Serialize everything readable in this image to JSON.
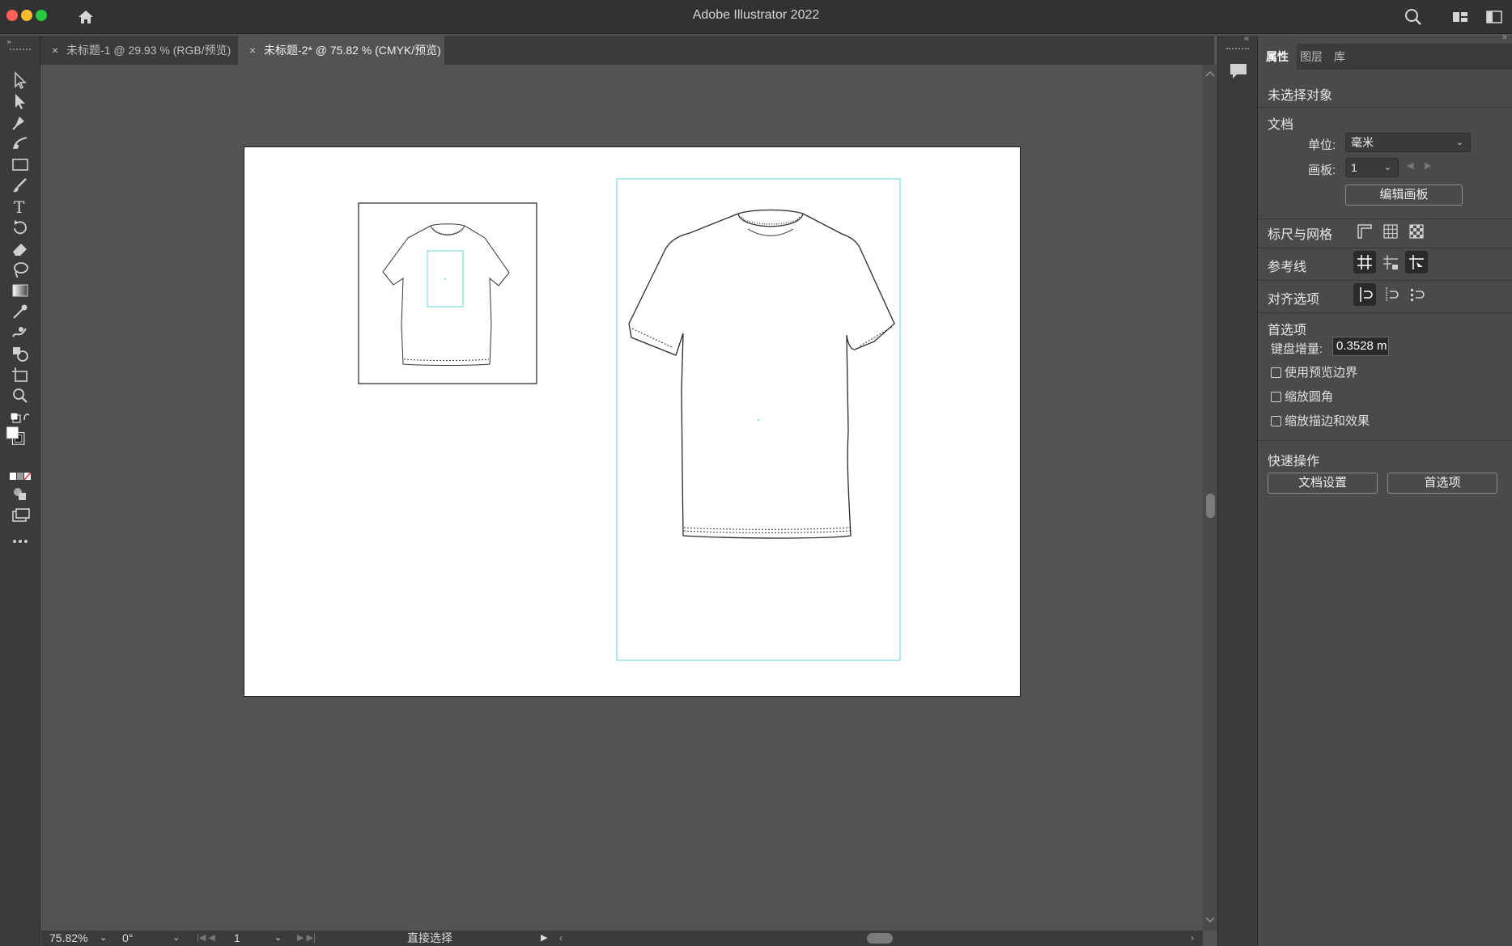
{
  "window": {
    "title": "Adobe Illustrator 2022"
  },
  "tabs": [
    {
      "label": "未标题-1 @ 29.93 % (RGB/预览)",
      "active": false
    },
    {
      "label": "未标题-2* @ 75.82 % (CMYK/预览)",
      "active": true
    }
  ],
  "panel": {
    "tabs": [
      "属性",
      "图层",
      "库"
    ],
    "selection_status": "未选择对象",
    "document_heading": "文档",
    "unit_label": "单位:",
    "unit_value": "毫米",
    "artboard_label": "画板:",
    "artboard_value": "1",
    "edit_artboard_button": "编辑画板",
    "rulers_grids_label": "标尺与网格",
    "guides_label": "参考线",
    "snap_label": "对齐选项",
    "prefs_heading": "首选项",
    "keyboard_increment_label": "键盘增量:",
    "keyboard_increment_value": "0.3528 m",
    "checkboxes": [
      "使用预览边界",
      "缩放圆角",
      "缩放描边和效果"
    ],
    "quick_actions_heading": "快速操作",
    "doc_setup_button": "文档设置",
    "preferences_button": "首选项"
  },
  "status": {
    "zoom": "75.82%",
    "rotation": "0°",
    "artboard_number": "1",
    "tool_name": "直接选择"
  },
  "colors": {
    "guide": "#7fd8e6",
    "accent": "#ffffff"
  }
}
